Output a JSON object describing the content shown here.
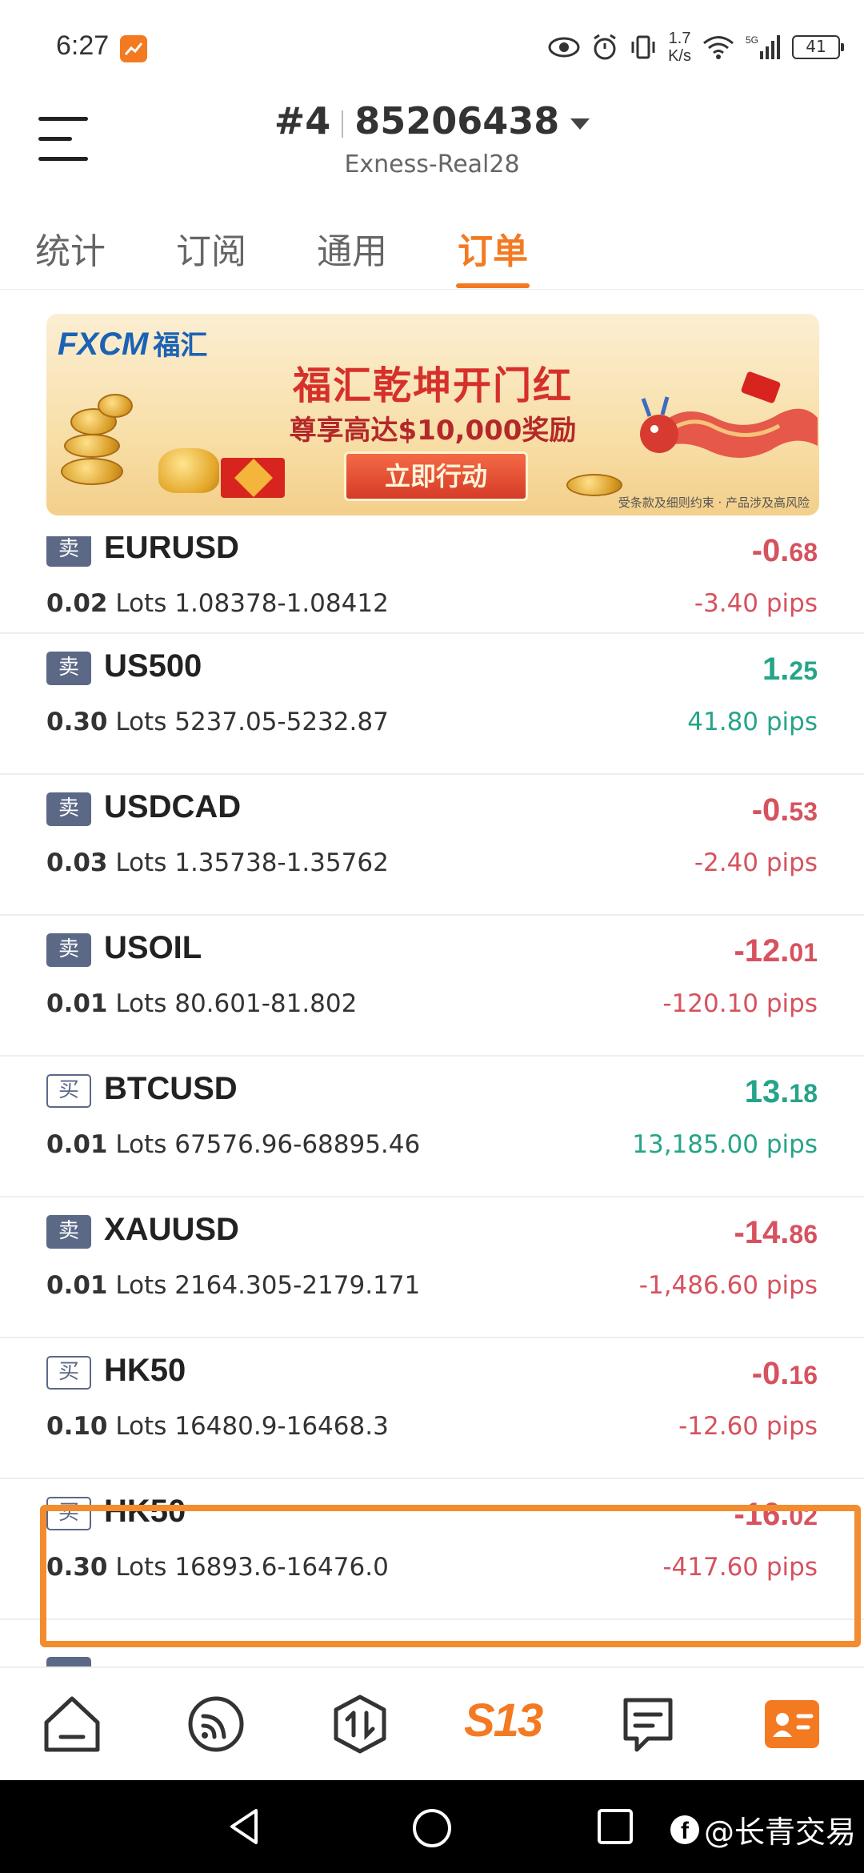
{
  "status_bar": {
    "time": "6:27",
    "net_speed_value": "1.7",
    "net_speed_unit": "K/s",
    "network": "5G",
    "battery": "41"
  },
  "header": {
    "account_index": "#4",
    "account_number": "85206438",
    "server": "Exness-Real28"
  },
  "tabs": [
    {
      "label": "统计",
      "active": false
    },
    {
      "label": "订阅",
      "active": false
    },
    {
      "label": "通用",
      "active": false
    },
    {
      "label": "订单",
      "active": true
    }
  ],
  "banner": {
    "logo": "FXCM",
    "logo_cn": "福汇",
    "headline": "福汇乾坤开门红",
    "subline": "尊享高达$10,000奖励",
    "cta": "立即行动",
    "disclaimer": "受条款及细则约束 · 产品涉及高风险"
  },
  "orders": [
    {
      "side": "卖",
      "side_type": "sell",
      "symbol": "EURUSD",
      "lots": "0.02",
      "lots_unit": "Lots",
      "prices": "1.08378-1.08412",
      "pnl_int": "-0.",
      "pnl_dec": "68",
      "pips": "-3.40 pips",
      "sign": "neg"
    },
    {
      "side": "卖",
      "side_type": "sell",
      "symbol": "US500",
      "lots": "0.30",
      "lots_unit": "Lots",
      "prices": "5237.05-5232.87",
      "pnl_int": "1.",
      "pnl_dec": "25",
      "pips": "41.80 pips",
      "sign": "pos"
    },
    {
      "side": "卖",
      "side_type": "sell",
      "symbol": "USDCAD",
      "lots": "0.03",
      "lots_unit": "Lots",
      "prices": "1.35738-1.35762",
      "pnl_int": "-0.",
      "pnl_dec": "53",
      "pips": "-2.40 pips",
      "sign": "neg"
    },
    {
      "side": "卖",
      "side_type": "sell",
      "symbol": "USOIL",
      "lots": "0.01",
      "lots_unit": "Lots",
      "prices": "80.601-81.802",
      "pnl_int": "-12.",
      "pnl_dec": "01",
      "pips": "-120.10 pips",
      "sign": "neg"
    },
    {
      "side": "买",
      "side_type": "buy",
      "symbol": "BTCUSD",
      "lots": "0.01",
      "lots_unit": "Lots",
      "prices": "67576.96-68895.46",
      "pnl_int": "13.",
      "pnl_dec": "18",
      "pips": "13,185.00 pips",
      "sign": "pos"
    },
    {
      "side": "卖",
      "side_type": "sell",
      "symbol": "XAUUSD",
      "lots": "0.01",
      "lots_unit": "Lots",
      "prices": "2164.305-2179.171",
      "pnl_int": "-14.",
      "pnl_dec": "86",
      "pips": "-1,486.60 pips",
      "sign": "neg"
    },
    {
      "side": "买",
      "side_type": "buy",
      "symbol": "HK50",
      "lots": "0.10",
      "lots_unit": "Lots",
      "prices": "16480.9-16468.3",
      "pnl_int": "-0.",
      "pnl_dec": "16",
      "pips": "-12.60 pips",
      "sign": "neg"
    },
    {
      "side": "买",
      "side_type": "buy",
      "symbol": "HK50",
      "lots": "0.30",
      "lots_unit": "Lots",
      "prices": "16893.6-16476.0",
      "pnl_int": "-16.",
      "pnl_dec": "02",
      "pips": "-417.60 pips",
      "sign": "neg"
    }
  ],
  "bottom_nav": {
    "logo": "S13",
    "icons": [
      "home-icon",
      "signal-icon",
      "trade-icon",
      "s13-logo",
      "message-icon",
      "profile-card-icon"
    ]
  },
  "watermark": {
    "text": "@长青交易"
  },
  "colors": {
    "accent": "#f47a22",
    "negative": "#d6525e",
    "positive": "#25a489",
    "badge": "#5b6987",
    "highlight": "#f28c2e"
  }
}
